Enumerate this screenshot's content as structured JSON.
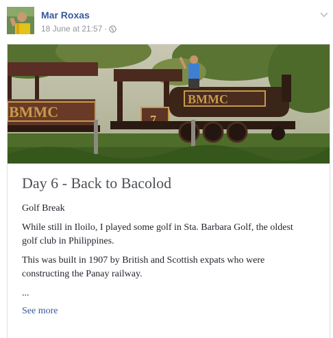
{
  "post": {
    "author": "Mar Roxas",
    "timestamp": "18 June at 21:57",
    "separator": "·",
    "privacy_icon": "globe-icon",
    "options_icon": "chevron-down-icon"
  },
  "photo": {
    "locomotive_left_lettering": "BMMC",
    "locomotive_right_lettering": "BMMC",
    "locomotive_number": "7"
  },
  "article": {
    "title": "Day 6 - Back to Bacolod",
    "paragraphs": [
      "Golf Break",
      "While still in Iloilo, I played some golf in Sta. Barbara Golf, the oldest golf club in Philippines.",
      "This was built in 1907 by British and Scottish expats who were constructing the Panay railway.",
      "..."
    ],
    "see_more": "See more"
  },
  "colors": {
    "link": "#365899",
    "meta": "#90949c",
    "title": "#4b4f56",
    "body": "#1d2129",
    "border": "#dddfe2"
  }
}
